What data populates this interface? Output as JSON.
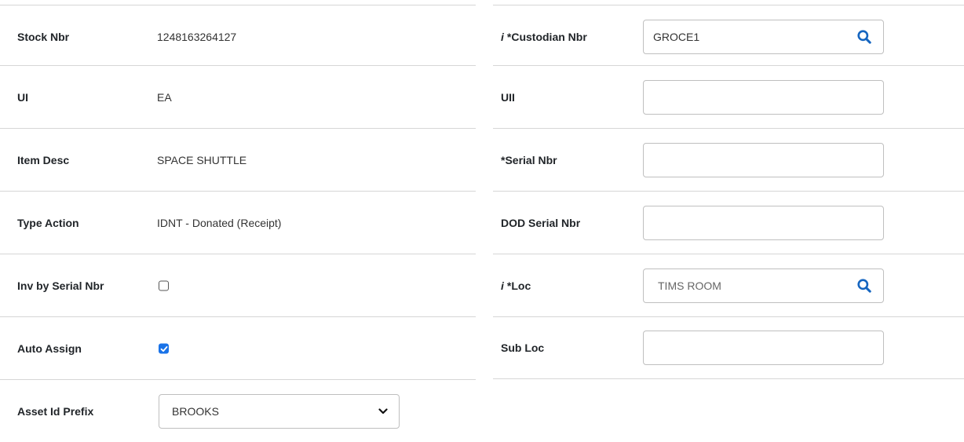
{
  "left": {
    "stock_nbr": {
      "label": "Stock Nbr",
      "value": "1248163264127"
    },
    "ui": {
      "label": "UI",
      "value": "EA"
    },
    "item_desc": {
      "label": "Item Desc",
      "value": "SPACE SHUTTLE"
    },
    "type_action": {
      "label": "Type Action",
      "value": "IDNT - Donated (Receipt)"
    },
    "inv_by_serial": {
      "label": "Inv by Serial Nbr",
      "checked": false
    },
    "auto_assign": {
      "label": "Auto Assign",
      "checked": true
    },
    "asset_id_prefix": {
      "label": "Asset Id Prefix",
      "selected": "BROOKS"
    }
  },
  "right": {
    "custodian_nbr": {
      "info": "i",
      "label": "*Custodian Nbr",
      "value": "GROCE1"
    },
    "uii": {
      "label": "UII",
      "value": ""
    },
    "serial_nbr": {
      "label": "*Serial Nbr",
      "value": ""
    },
    "dod_serial_nbr": {
      "label": "DOD Serial Nbr",
      "value": ""
    },
    "loc": {
      "info": "i",
      "label": "*Loc",
      "placeholder": "TIMS ROOM"
    },
    "sub_loc": {
      "label": "Sub Loc",
      "value": ""
    }
  },
  "colors": {
    "accent": "#1a73e8",
    "search_icon": "#1565c0",
    "divider": "#d6d6d6"
  }
}
